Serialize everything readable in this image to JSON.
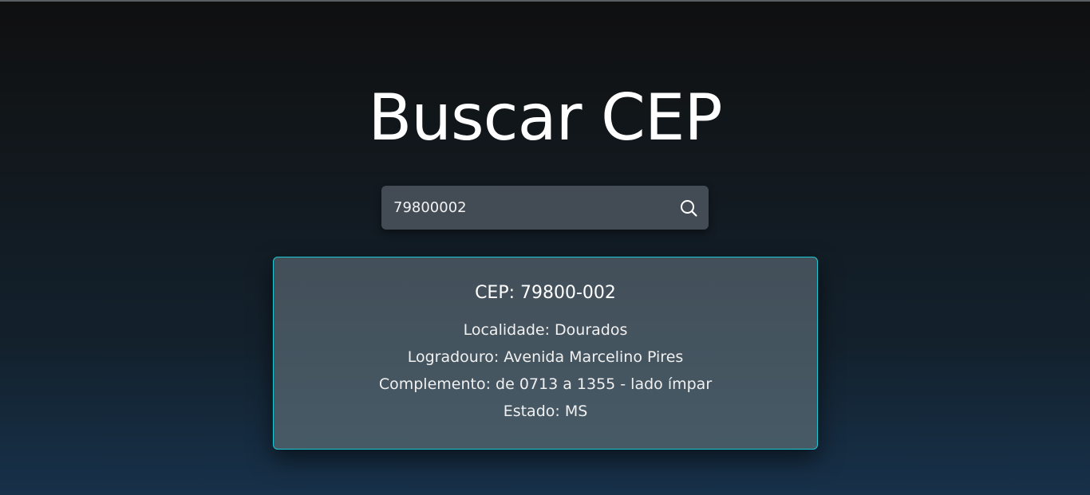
{
  "page": {
    "title": "Buscar CEP"
  },
  "search": {
    "value": "79800002",
    "icon": "search-icon"
  },
  "result": {
    "heading": "CEP: 79800-002",
    "localidade": "Localidade: Dourados",
    "logradouro": "Logradouro: Avenida Marcelino Pires",
    "complemento": "Complemento: de 0713 a 1355 - lado ímpar",
    "estado": "Estado: MS"
  },
  "colors": {
    "accent_border": "#18c9d6",
    "search_bg": "#434c55",
    "card_bg": "#465a66"
  }
}
